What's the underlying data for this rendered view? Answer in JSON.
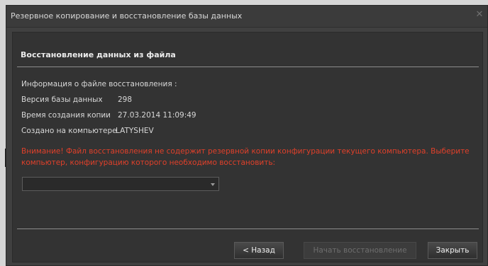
{
  "window": {
    "title": "Резервное копирование и восстановление базы данных",
    "close_glyph": "✕"
  },
  "section": {
    "title": "Восстановление данных из файла"
  },
  "file_info": {
    "header": "Информация о файле восстановления :",
    "db_version_label": "Версия базы данных",
    "db_version_value": "298",
    "created_time_label": "Время создания копии",
    "created_time_value": "27.03.2014 11:09:49",
    "created_on_label": "Создано на компьютере",
    "created_on_value": "LATYSHEV"
  },
  "warning": {
    "text": "Внимание! Файл восстановления не содержит резервной копии конфигурации текущего компьютера. Выберите компьютер, конфигурацию которого необходимо восстановить:",
    "color": "#e0402a"
  },
  "computer_select": {
    "selected": ""
  },
  "buttons": {
    "back": "< Назад",
    "start_restore": "Начать восстановление",
    "close": "Закрыть"
  },
  "icons": {
    "close": "close-icon",
    "dropdown": "chevron-down-icon"
  }
}
